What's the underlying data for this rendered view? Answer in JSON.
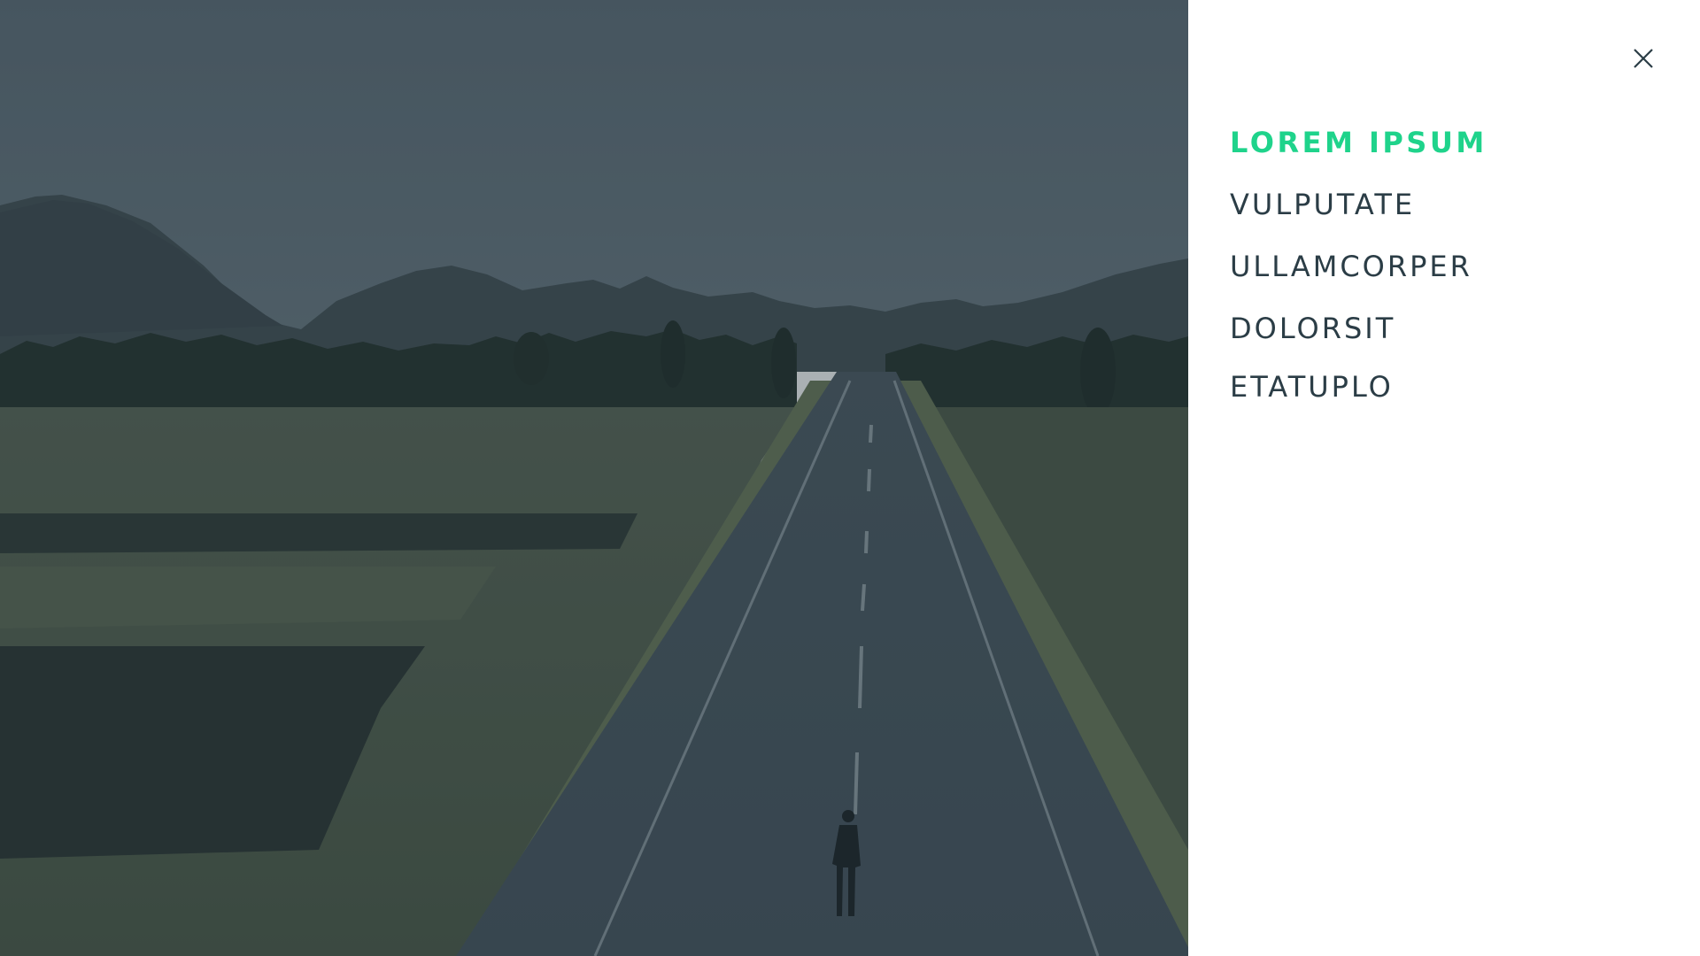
{
  "hero": {
    "icon": "road-landscape-photo"
  },
  "menu": {
    "close_icon": "close-icon",
    "accent_color": "#1fd38b",
    "text_color": "#2b3d46",
    "items": [
      {
        "label": "LOREM IPSUM",
        "active": true
      },
      {
        "label": "VULPUTATE",
        "active": false
      },
      {
        "label": "ULLAMCORPER",
        "active": false
      },
      {
        "label": "DOLORSIT",
        "active": false
      },
      {
        "label": "ETATUPLO",
        "active": false
      }
    ]
  }
}
